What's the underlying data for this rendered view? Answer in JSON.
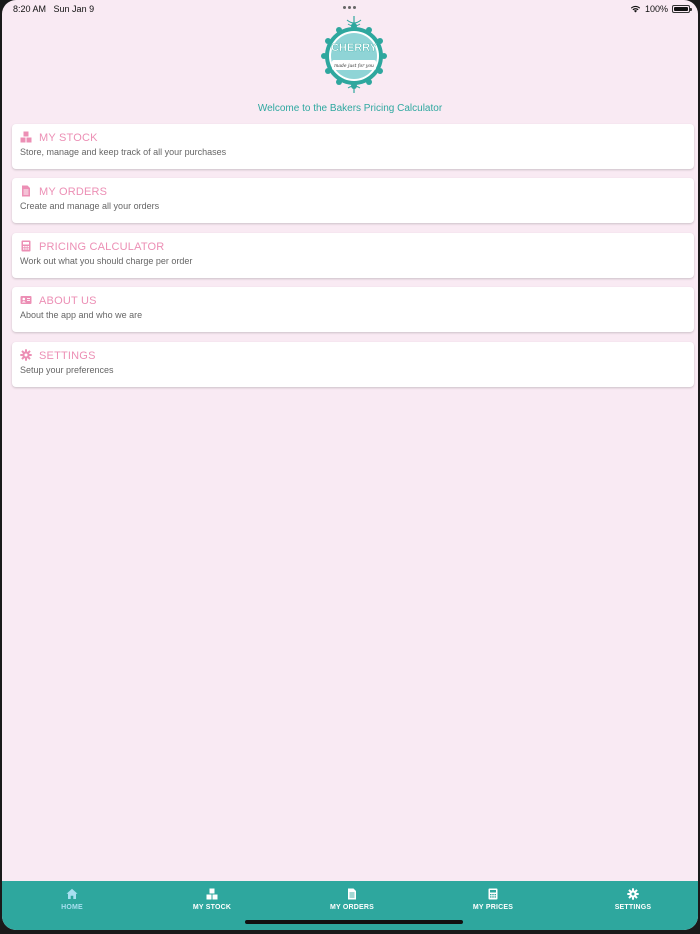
{
  "status_bar": {
    "time": "8:20 AM",
    "date": "Sun Jan 9",
    "battery": "100%"
  },
  "logo": {
    "brand_text": "CHERRY",
    "tagline": "made just for you"
  },
  "welcome_text": "Welcome to the Bakers Pricing Calculator",
  "menu": {
    "items": [
      {
        "title": "MY STOCK",
        "description": "Store, manage and keep track of all your purchases",
        "icon": "boxes-icon"
      },
      {
        "title": "MY ORDERS",
        "description": "Create and manage all your orders",
        "icon": "document-icon"
      },
      {
        "title": "PRICING CALCULATOR",
        "description": "Work out what you should charge per order",
        "icon": "calculator-icon"
      },
      {
        "title": "ABOUT US",
        "description": "About the app and who we are",
        "icon": "id-card-icon"
      },
      {
        "title": "SETTINGS",
        "description": "Setup your preferences",
        "icon": "gear-icon"
      }
    ]
  },
  "tabbar": {
    "tabs": [
      {
        "label": "HOME",
        "icon": "home-icon",
        "active": true
      },
      {
        "label": "MY STOCK",
        "icon": "boxes-icon",
        "active": false
      },
      {
        "label": "MY ORDERS",
        "icon": "document-icon",
        "active": false
      },
      {
        "label": "MY PRICES",
        "icon": "calculator-icon",
        "active": false
      },
      {
        "label": "SETTINGS",
        "icon": "gear-icon",
        "active": false
      }
    ]
  },
  "colors": {
    "background": "#f9eaf3",
    "accent_teal": "#2ea79e",
    "menu_title_pink": "#ec8fb5",
    "active_tab": "#a8dff0"
  }
}
